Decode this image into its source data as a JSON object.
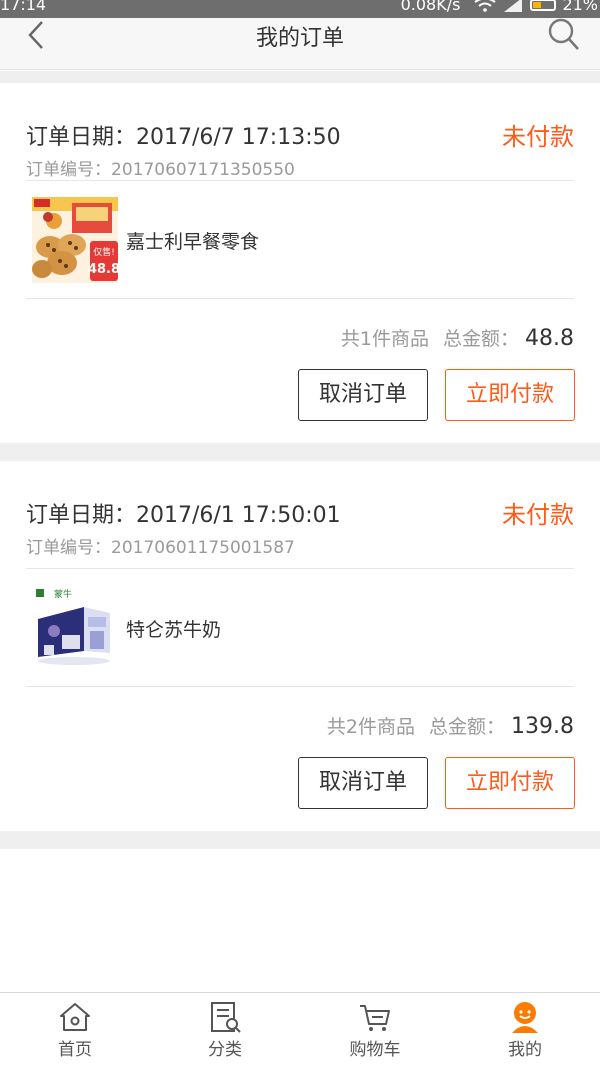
{
  "status_bar": {
    "time": "17:14",
    "network_speed": "0.08K/s",
    "battery": "21%"
  },
  "header": {
    "title": "我的订单"
  },
  "orders": [
    {
      "date": "订单日期：2017/6/7 17:13:50",
      "status": "未付款",
      "serial": "订单编号：20170607171350550",
      "product_name": "嘉士利早餐零食",
      "count_text": "共1件商品",
      "total_label": "总金额：",
      "total_value": "48.8",
      "cancel_label": "取消订单",
      "pay_label": "立即付款",
      "thumb_badge_text": "仅售!",
      "thumb_price_text": "48.8"
    },
    {
      "date": "订单日期：2017/6/1 17:50:01",
      "status": "未付款",
      "serial": "订单编号：20170601175001587",
      "product_name": "特仑苏牛奶",
      "count_text": "共2件商品",
      "total_label": "总金额：",
      "total_value": "139.8",
      "cancel_label": "取消订单",
      "pay_label": "立即付款",
      "thumb_badge_text": "蒙牛"
    }
  ],
  "tabbar": {
    "items": [
      {
        "label": "首页",
        "icon": "home-icon"
      },
      {
        "label": "分类",
        "icon": "category-icon"
      },
      {
        "label": "购物车",
        "icon": "cart-icon"
      },
      {
        "label": "我的",
        "icon": "profile-icon"
      }
    ],
    "active": 3
  },
  "colors": {
    "accent": "#ff5a19",
    "profile_active": "#ff7a00",
    "gap": "#efefef"
  }
}
